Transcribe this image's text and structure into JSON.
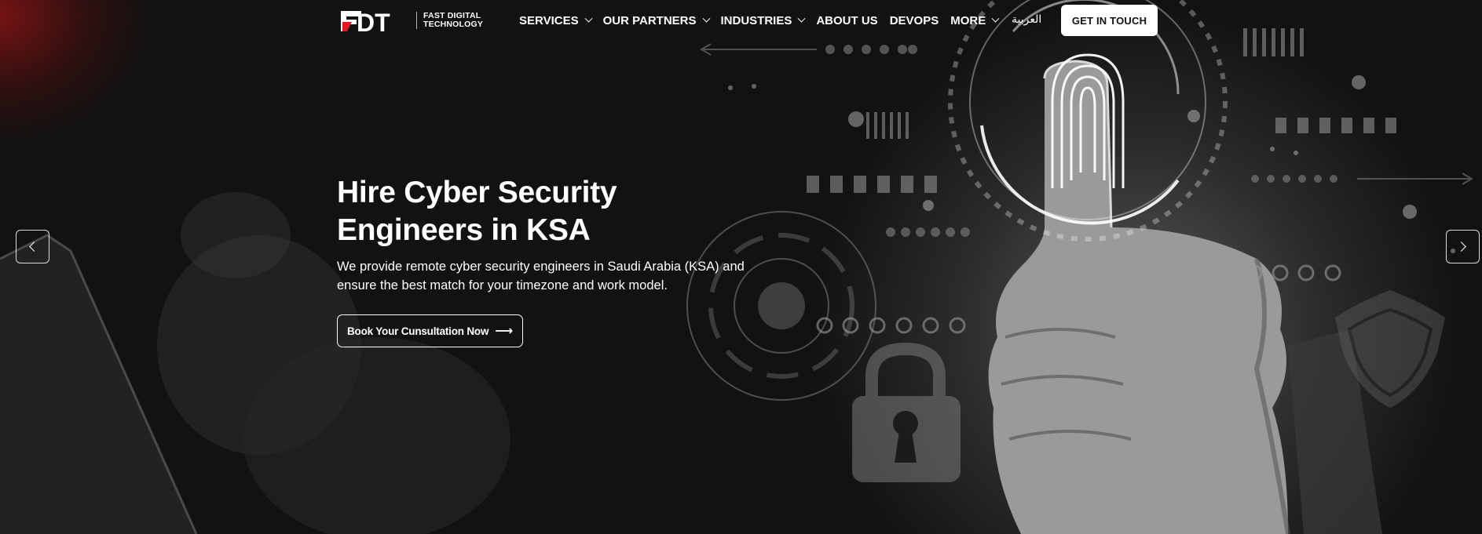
{
  "brand": {
    "logo_text": "FDT",
    "name_line1": "FAST DIGITAL",
    "name_line2": "TECHNOLOGY"
  },
  "nav": {
    "items": [
      {
        "label": "SERVICES",
        "has_dropdown": true
      },
      {
        "label": "OUR PARTNERS",
        "has_dropdown": true
      },
      {
        "label": "INDUSTRIES",
        "has_dropdown": true
      },
      {
        "label": "ABOUT US",
        "has_dropdown": false
      },
      {
        "label": "DEVOPS",
        "has_dropdown": false
      },
      {
        "label": "MORE",
        "has_dropdown": true
      }
    ],
    "language": "العربية",
    "cta": "GET IN TOUCH"
  },
  "hero": {
    "title_line1": "Hire Cyber Security",
    "title_line2": "Engineers in KSA",
    "subtitle_line1": "We provide remote cyber security engineers in Saudi Arabia (KSA) and",
    "subtitle_line2": "ensure the best match for your timezone and work model.",
    "button_label": "Book Your Cunsultation Now",
    "button_icon": "arrow-right-icon"
  },
  "slider": {
    "prev_icon": "chevron-left-icon",
    "next_icon": "chevron-right-icon"
  },
  "colors": {
    "brand_red": "#e3191f",
    "accent_red_glow": "#8c1414",
    "text": "#ffffff",
    "cta_bg": "#ffffff"
  }
}
